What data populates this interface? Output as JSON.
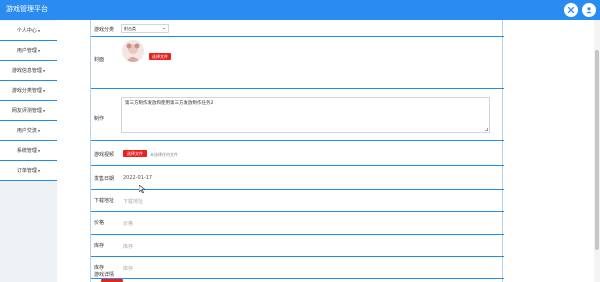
{
  "header": {
    "title": "游戏管理平台",
    "close_icon": "close-icon",
    "user_icon": "user-icon",
    "accent": "#2a8cf0"
  },
  "sidebar": {
    "items": [
      {
        "label": "个人中心"
      },
      {
        "label": "用户管理"
      },
      {
        "label": "游戏信息管理"
      },
      {
        "label": "游戏分类管理"
      },
      {
        "label": "网友评测管理"
      },
      {
        "label": "用户交流"
      },
      {
        "label": "系统管理"
      },
      {
        "label": "订单管理"
      }
    ]
  },
  "form": {
    "category": {
      "label": "游戏分类",
      "value": "射击类"
    },
    "cover": {
      "label": "封面",
      "upload_label": "选择文件"
    },
    "maker": {
      "label": "制作",
      "value": "第三方制作发放和使用第三方发放制作任务2"
    },
    "video": {
      "label": "游戏视频",
      "upload_label": "选择文件",
      "hint": "未选择任何文件"
    },
    "release_date": {
      "label": "发售日期",
      "value": "2022-01-17"
    },
    "download": {
      "label": "下载地址",
      "value": "下载地址"
    },
    "price": {
      "label": "价格",
      "value": "价格"
    },
    "stock_a": {
      "label": "库存",
      "value": "库存"
    },
    "stock_b": {
      "label": "库存",
      "value": "库存"
    },
    "detail": {
      "label": "游戏详情"
    }
  },
  "colors": {
    "primary": "#2a8cf0",
    "danger": "#e8231f",
    "divider": "#1f8ef1"
  }
}
